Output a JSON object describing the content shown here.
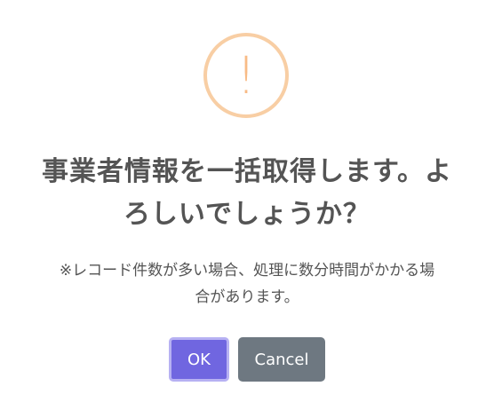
{
  "dialog": {
    "icon": {
      "name": "warning-icon",
      "glyph": "!",
      "ring_color": "#f8cea4",
      "glyph_color": "#f8bb86"
    },
    "title_line1": "事業者情報を一括取得します。よ",
    "title_line2": "ろしいでしょうか？",
    "message_line1": "※レコード件数が多い場合、処理に数分時間がかかる場",
    "message_line2": "合があります。",
    "buttons": {
      "ok_label": "OK",
      "cancel_label": "Cancel"
    },
    "colors": {
      "ok_background": "#7066e0",
      "cancel_background": "#6e7881",
      "text": "#545454"
    }
  }
}
